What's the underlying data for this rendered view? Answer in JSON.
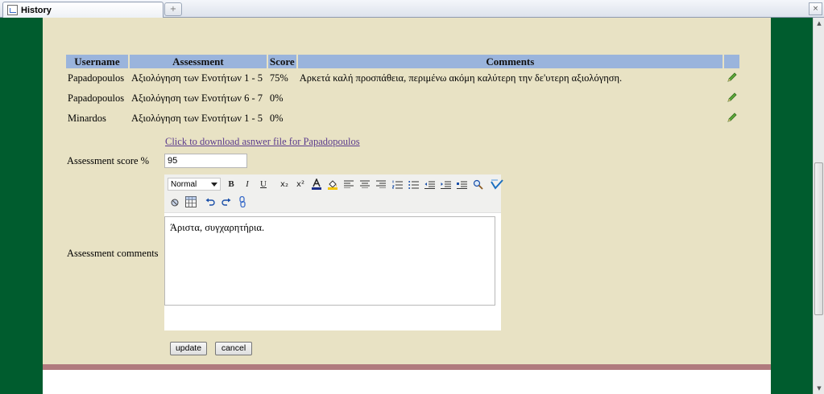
{
  "browser": {
    "tab_title": "History",
    "new_tab_symbol": "+",
    "close_symbol": "×"
  },
  "history_table": {
    "headers": [
      "Username",
      "Assessment",
      "Score",
      "Comments"
    ],
    "rows": [
      {
        "username": "Papadopoulos",
        "assessment": "Αξιολόγηση των Ενοτήτων 1 - 5",
        "score": "75%",
        "comment": "Αρκετά καλή προσπάθεια, περιμένω ακόμη καλύτερη την δε'υτερη αξιολόγηση."
      },
      {
        "username": "Papadopoulos",
        "assessment": "Αξιολόγηση των Ενοτήτων 6 - 7",
        "score": "0%",
        "comment": ""
      },
      {
        "username": "Minardos",
        "assessment": "Αξιολόγηση των Ενοτήτων 1 - 5",
        "score": "0%",
        "comment": ""
      }
    ],
    "edit_icon": "pencil-icon"
  },
  "form": {
    "download_link": "Click to download asnwer file for Papadopoulos",
    "score_label": "Assessment score %",
    "score_value": "95",
    "comments_label": "Assessment comments",
    "comments_value": "Άριστα, συγχαρητήρια.",
    "update_label": "update",
    "cancel_label": "cancel"
  },
  "editor": {
    "format_value": "Normal",
    "bold": "B",
    "italic": "I",
    "underline": "U",
    "subscript": "x₂",
    "superscript": "x²"
  },
  "colors": {
    "outer_background": "#005c2e",
    "content_background": "#e8e2c4",
    "header_background": "#9ab4dc",
    "footer_band": "#b07a7e",
    "link": "#5a3a8c"
  }
}
